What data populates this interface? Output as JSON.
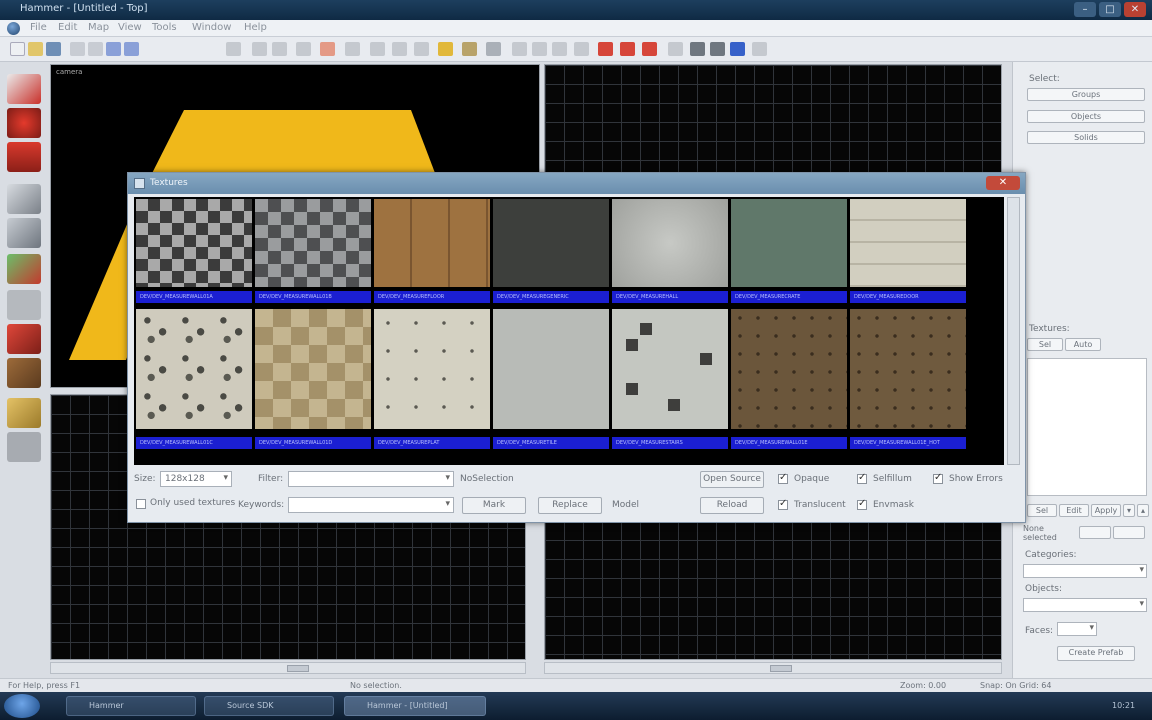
{
  "window": {
    "title": "Hammer - [Untitled - Top]"
  },
  "menu": [
    "File",
    "Edit",
    "Map",
    "View",
    "Tools",
    "Window",
    "Help"
  ],
  "viewport_3d_label": "camera",
  "right_panel": {
    "select_label": "Select:",
    "buttons": [
      "Groups",
      "Objects",
      "Solids"
    ],
    "textures_label": "Textures:",
    "tabs": [
      "Sel",
      "Auto"
    ],
    "bottom_tabs": [
      "Sel",
      "Edit",
      "Apply"
    ],
    "none_selected": "None selected",
    "categories_label": "Categories:",
    "objects_label": "Objects:",
    "faces_label": "Faces:",
    "create_prefab": "Create Prefab"
  },
  "dialog": {
    "title": "Textures",
    "tile_labels_row1": [
      "DEV/DEV_MEASUREWALL01A",
      "DEV/DEV_MEASUREWALL01B",
      "DEV/DEV_MEASUREFLOOR",
      "DEV/DEV_MEASUREGENERIC",
      "DEV/DEV_MEASUREHALL",
      "DEV/DEV_MEASURECRATE",
      "DEV/DEV_MEASUREDOOR"
    ],
    "tile_labels_row2": [
      "DEV/DEV_MEASUREWALL01C",
      "DEV/DEV_MEASUREWALL01D",
      "DEV/DEV_MEASUREPLAT",
      "DEV/DEV_MEASURETILE",
      "DEV/DEV_MEASURESTAIRS",
      "DEV/DEV_MEASUREWALL01E",
      "DEV/DEV_MEASUREWALL01E_HOT"
    ],
    "size_label": "Size:",
    "size_value": "128x128",
    "filter_label": "Filter:",
    "only_used_label": "Only used textures",
    "keywords_label": "Keywords:",
    "no_selection_label": "NoSelection",
    "open_source": "Open Source",
    "mark": "Mark",
    "replace": "Replace",
    "reload": "Reload",
    "model_label": "Model",
    "checks": [
      "Opaque",
      "Selfillum",
      "Show Errors",
      "Translucent",
      "Envmask"
    ]
  },
  "status": {
    "left": "For Help, press F1",
    "mid": "No selection.",
    "zoom": "Zoom: 0.00",
    "snap": "Snap: On Grid: 64"
  },
  "taskbar": {
    "tasks": [
      "Hammer",
      "Source SDK",
      "Hammer - [Untitled]"
    ],
    "clock": "10:21"
  },
  "colors": {
    "accent": "#1b1fd2",
    "viewport_bg": "#060606",
    "brush": "#f0b81a"
  }
}
